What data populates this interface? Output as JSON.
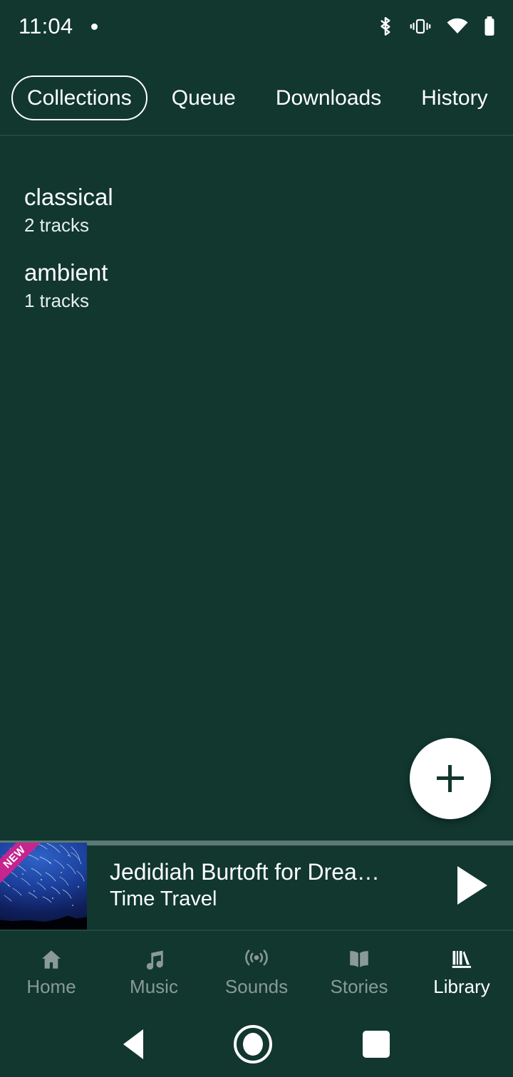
{
  "statusbar": {
    "time": "11:04",
    "icons": [
      "notification-dot",
      "bluetooth-icon",
      "vibrate-icon",
      "wifi-icon",
      "battery-icon"
    ]
  },
  "tabs": [
    {
      "label": "Collections",
      "selected": true
    },
    {
      "label": "Queue",
      "selected": false
    },
    {
      "label": "Downloads",
      "selected": false
    },
    {
      "label": "History",
      "selected": false
    }
  ],
  "collections": [
    {
      "title": "classical",
      "subtitle": "2 tracks"
    },
    {
      "title": "ambient",
      "subtitle": "1 tracks"
    }
  ],
  "fab": {
    "label": "+",
    "icon": "plus-icon"
  },
  "miniplayer": {
    "title": "Jedidiah Burtoft for Drea…",
    "subtitle": "Time Travel",
    "badge": "NEW",
    "play_icon": "play-icon",
    "artwork_alt": "night-sky-star-trails",
    "progress_percent": 0
  },
  "bottomnav": [
    {
      "label": "Home",
      "icon": "home-icon",
      "active": false
    },
    {
      "label": "Music",
      "icon": "music-note-icon",
      "active": false
    },
    {
      "label": "Sounds",
      "icon": "broadcast-icon",
      "active": false
    },
    {
      "label": "Stories",
      "icon": "book-icon",
      "active": false
    },
    {
      "label": "Library",
      "icon": "library-books-icon",
      "active": true
    }
  ],
  "sysnav": [
    {
      "name": "back-button",
      "icon": "triangle-left-icon"
    },
    {
      "name": "home-button",
      "icon": "circle-icon"
    },
    {
      "name": "recents-button",
      "icon": "square-icon"
    }
  ],
  "colors": {
    "background": "#11372f",
    "accent_badge": "#c6248e",
    "active_text": "#ffffff",
    "inactive_text": "#8a9a96",
    "divider": "#1f4a41",
    "progress_track": "#5c7974"
  }
}
